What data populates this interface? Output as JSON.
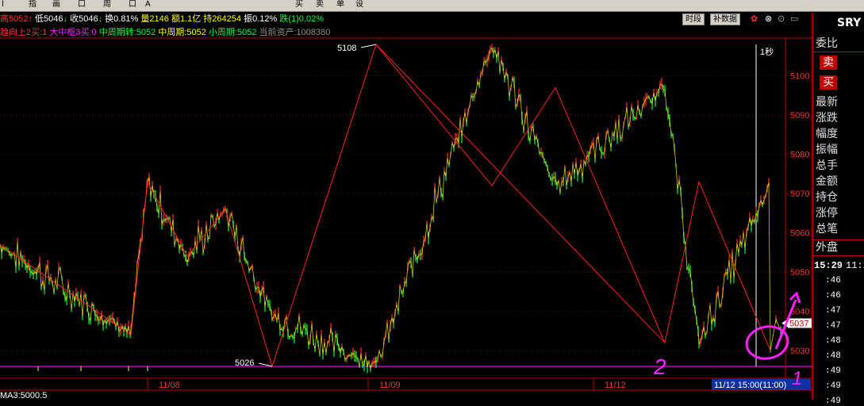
{
  "toolbar": {
    "items": [
      "Ⅰ",
      "指",
      "画",
      "口",
      "周",
      "口",
      "A",
      "买",
      "卖",
      "单",
      "设"
    ]
  },
  "info_line1": {
    "high": "高5052",
    "low": "低5046",
    "close": "收5046",
    "turnover": "换0.81%",
    "volume": "量2146",
    "amount": "额1.1亿",
    "open_interest": "持264254",
    "amplitude": "振0.12%",
    "change": "跌(1)0.02%"
  },
  "info_line2": {
    "a": "趋向上2买:1",
    "b": "大中枢3买:0",
    "c": "中周期转:5052",
    "d": "中周期:5052",
    "e": "小周期:5052",
    "f": "当前资产:1008380"
  },
  "buttons": {
    "timeshare": "时段",
    "adjust": "补数据"
  },
  "right_panel": {
    "symbol": "SRY",
    "labels": [
      "委比",
      "卖",
      "买",
      "最新",
      "涨跌",
      "幅度",
      "振幅",
      "总手",
      "金额",
      "持仓",
      "涨停",
      "总笔",
      "外盘"
    ],
    "time_header": "15:29",
    "time_header2": "11:2",
    "times": [
      ":46",
      ":46",
      ":47",
      ":47",
      ":48",
      ":48",
      ":49",
      ":49",
      ":49"
    ]
  },
  "chart_data": {
    "type": "line",
    "title": "",
    "x_tick_labels": [
      "11/08",
      "11/09",
      "11/12"
    ],
    "y_tick_labels": [
      "5100",
      "5090",
      "5080",
      "5070",
      "5060",
      "5050",
      "5040",
      "5030"
    ],
    "ylim": [
      5026,
      5108
    ],
    "annotations": [
      "5108",
      "5026",
      "1秒",
      "5037"
    ],
    "status_time": "11/12 15:00(11:00)",
    "bottom_label": "MA3:5000.5",
    "handwritten": [
      "2",
      "1"
    ],
    "zigzag": [
      5057,
      5034,
      5073,
      5054,
      5066,
      5039,
      5026,
      5108,
      5072,
      5097,
      5032,
      5073,
      5030
    ],
    "colors": {
      "up": "#ff3030",
      "down": "#00ff40",
      "zigzag": "#ff2020",
      "yellow": "#ffff00",
      "annotate": "#ff20ff"
    }
  }
}
